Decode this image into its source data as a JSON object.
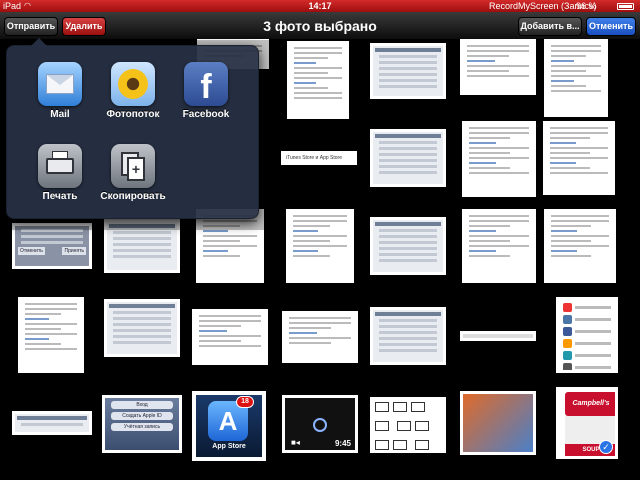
{
  "status_bar": {
    "carrier": "iPad",
    "wifi_icon": "wifi-icon",
    "time": "14:17",
    "app": "RecordMyScreen (Запись)",
    "battery": "96 %",
    "battery_icon": "battery-icon",
    "color": "#b81a1a"
  },
  "nav_bar": {
    "share_label": "Отправить",
    "delete_label": "Удалить",
    "title": "3 фото выбрано",
    "add_label": "Добавить в...",
    "cancel_label": "Отменить",
    "delete_color": "#c62828",
    "cancel_color": "#2563d8"
  },
  "share_popover": {
    "items": [
      {
        "label": "Mail",
        "icon": "mail-icon"
      },
      {
        "label": "Фотопоток",
        "icon": "photo-stream-icon"
      },
      {
        "label": "Facebook",
        "icon": "facebook-icon"
      },
      {
        "label": "Печать",
        "icon": "printer-icon"
      },
      {
        "label": "Скопировать",
        "icon": "copy-icon"
      }
    ]
  },
  "thumbnails": {
    "itunes_label": "iTunes Store и App Store",
    "dialog_cancel": "Отменить",
    "dialog_next": "Принять",
    "login_items": [
      "Вход",
      "Создать Apple ID",
      "Учётная запись"
    ],
    "appstore_badge": "18",
    "appstore_label": "App Store",
    "video_time": "9:45",
    "soup_brand": "Campbell's",
    "soup_word": "SOUP",
    "selected_check": "check-icon"
  }
}
